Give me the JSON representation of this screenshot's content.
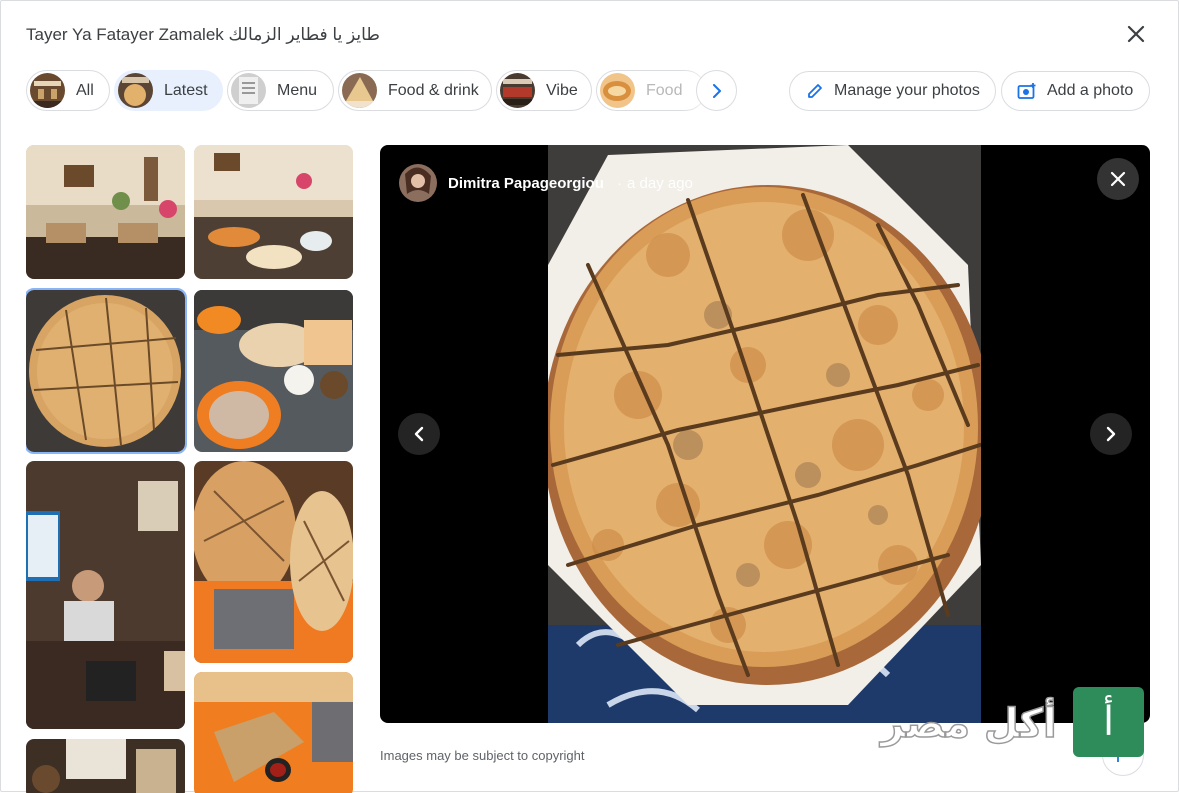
{
  "dialog": {
    "title": "Tayer Ya Fatayer Zamalek طايز يا فطاير الزمالك",
    "close_icon": "close-icon"
  },
  "chips": [
    {
      "label": "All",
      "active": false
    },
    {
      "label": "Latest",
      "active": true
    },
    {
      "label": "Menu",
      "active": false
    },
    {
      "label": "Food & drink",
      "active": false
    },
    {
      "label": "Vibe",
      "active": false
    },
    {
      "label": "Food",
      "active": false
    }
  ],
  "chips_next_icon": "chevron-right-icon",
  "actions": {
    "manage_photos": "Manage your photos",
    "add_photo": "Add a photo"
  },
  "grid": {
    "photos": [
      {
        "desc": "Restaurant interior with tables and hanging lamps"
      },
      {
        "desc": "Table with fatayer, salads and drinks"
      },
      {
        "desc": "Square-cut round fatayer pie",
        "selected": true
      },
      {
        "desc": "Spread of dishes on orange plates"
      },
      {
        "desc": "Cashier at counter"
      },
      {
        "desc": "Two sliced fatayer on table"
      },
      {
        "desc": "Seating area"
      },
      {
        "desc": "Fatayer with dipping sauce on orange tray"
      }
    ]
  },
  "viewer": {
    "author": "Dimitra Papageorgiou",
    "separator": "·",
    "time": "a day ago"
  },
  "footer": {
    "copyright": "Images may be subject to copyright"
  },
  "watermark": {
    "text": "أكل مصر",
    "letter": "أ"
  },
  "colors": {
    "chip_active_bg": "#e8f0fe",
    "selected_outline": "#8ab4f8",
    "viewer_bg": "#000000",
    "watermark_green": "#2e8b5a"
  }
}
